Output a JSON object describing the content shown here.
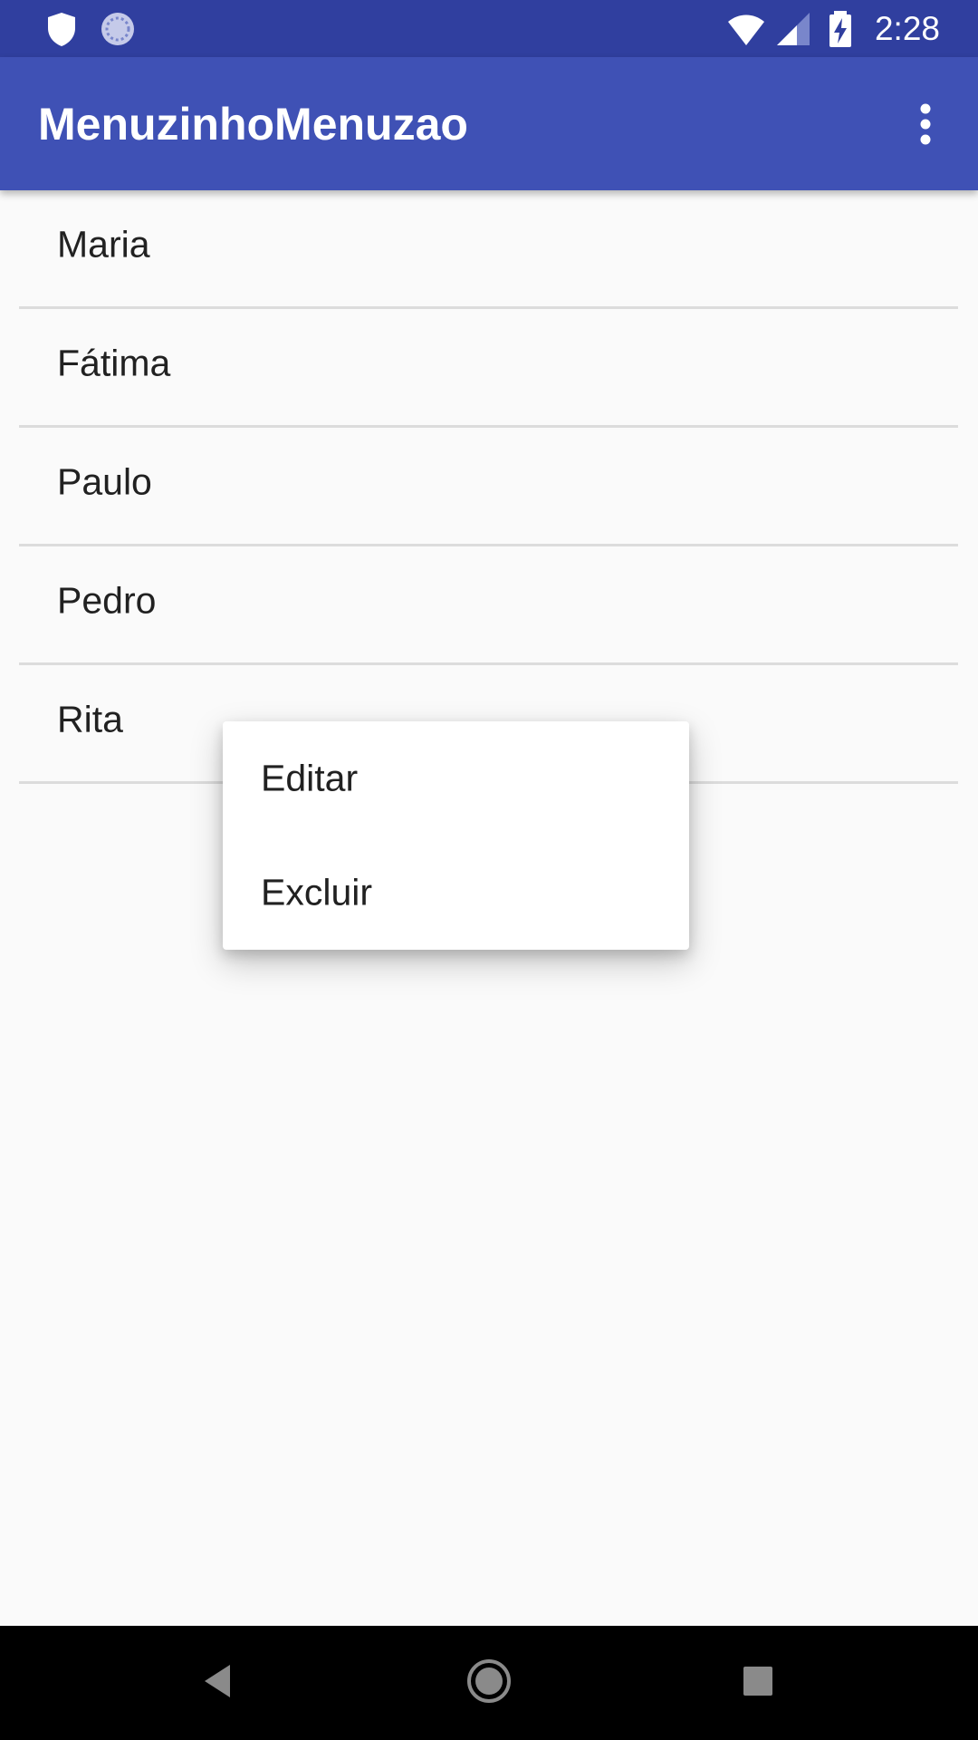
{
  "status_bar": {
    "time": "2:28",
    "left_icons": [
      "shield-icon",
      "sync-icon"
    ],
    "right_icons": [
      "wifi-icon",
      "signal-icon",
      "battery-charging-icon"
    ],
    "color": "#303f9f"
  },
  "app_bar": {
    "title": "MenuzinhoMenuzao",
    "overflow_icon": "more-vert-icon",
    "color": "#3f51b5"
  },
  "list": {
    "items": [
      {
        "label": "Maria"
      },
      {
        "label": "Fátima"
      },
      {
        "label": "Paulo"
      },
      {
        "label": "Pedro"
      },
      {
        "label": "Rita"
      }
    ]
  },
  "context_menu": {
    "items": [
      {
        "label": "Editar"
      },
      {
        "label": "Excluir"
      }
    ]
  },
  "nav_bar": {
    "buttons": [
      "back-icon",
      "home-icon",
      "recents-icon"
    ]
  }
}
